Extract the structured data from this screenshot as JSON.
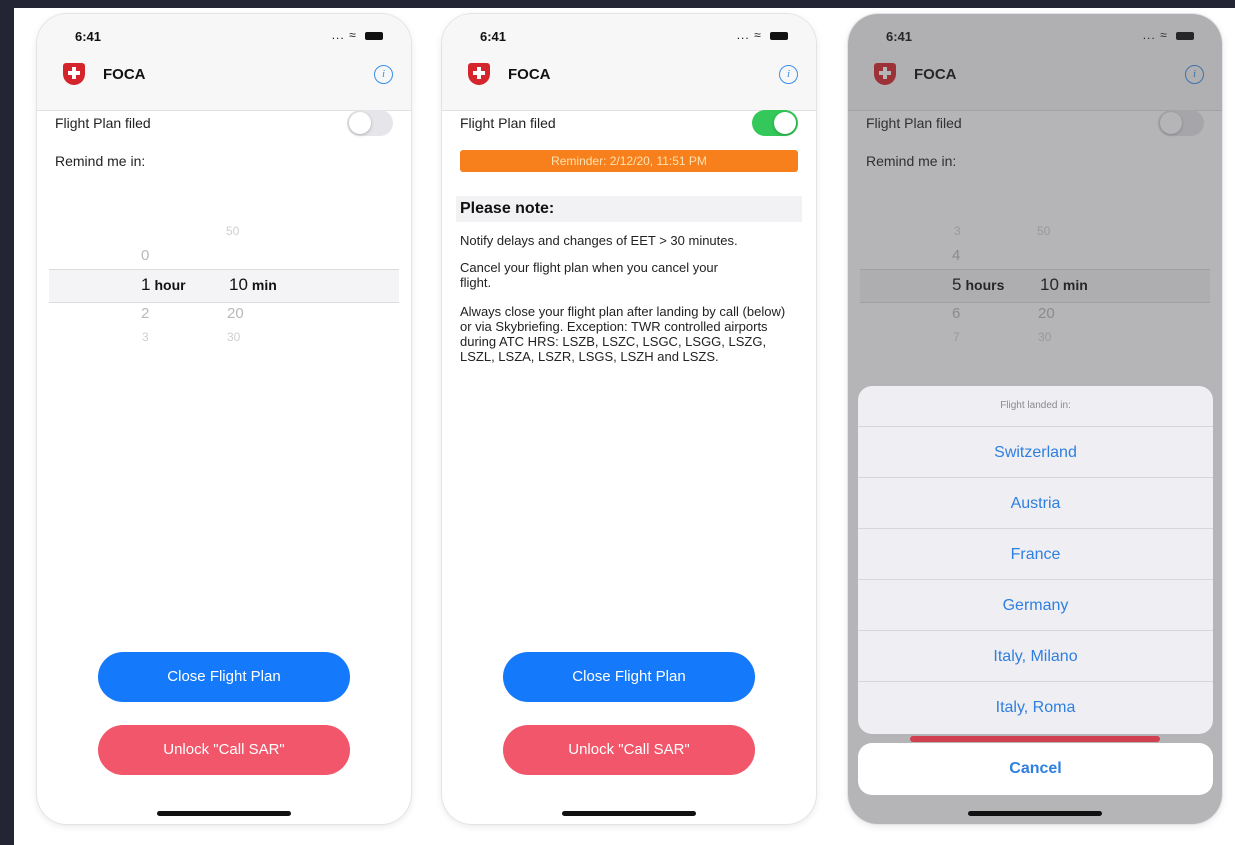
{
  "screens": [
    {
      "time": "6:41",
      "signal": "...",
      "app_title": "FOCA",
      "flight_plan_label": "Flight Plan filed",
      "remind_label": "Remind me in:",
      "toggle_on": false,
      "picker": {
        "hours_above": [
          "",
          "0"
        ],
        "hour_selected": "1",
        "hour_unit": "hour",
        "hours_below": [
          "2",
          "3",
          ""
        ],
        "mins_above": [
          "",
          "50",
          ""
        ],
        "min_selected": "10",
        "min_unit": "min",
        "mins_below": [
          "20",
          "30",
          ""
        ]
      },
      "close_button": "Close Flight Plan",
      "sar_button": "Unlock \"Call SAR\""
    },
    {
      "time": "6:41",
      "signal": "...",
      "app_title": "FOCA",
      "flight_plan_label": "Flight Plan filed",
      "toggle_on": true,
      "reminder": "Reminder: 2/12/20, 11:51 PM",
      "note_title": "Please note:",
      "notes": [
        "Notify delays and changes of EET > 30 minutes.",
        "Cancel your flight plan when you cancel your flight.",
        "Always close your flight plan after landing by call (below) or via Skybriefing. Exception: TWR controlled airports during ATC HRS: LSZB, LSZC, LSGC, LSGG, LSZG, LSZL, LSZA, LSZR, LSGS, LSZH and LSZS."
      ],
      "close_button": "Close Flight Plan",
      "sar_button": "Unlock \"Call SAR\""
    },
    {
      "time": "6:41",
      "signal": "...",
      "app_title": "FOCA",
      "flight_plan_label": "Flight Plan filed",
      "remind_label": "Remind me in:",
      "toggle_on": false,
      "picker": {
        "hours_above": [
          "3",
          "4"
        ],
        "hour_selected": "5",
        "hour_unit": "hours",
        "hours_below": [
          "6",
          "7",
          ""
        ],
        "mins_above": [
          "",
          "50",
          ""
        ],
        "min_selected": "10",
        "min_unit": "min",
        "mins_below": [
          "20",
          "30",
          ""
        ]
      },
      "sheet_title": "Flight landed in:",
      "options": [
        "Switzerland",
        "Austria",
        "France",
        "Germany",
        "Italy, Milano",
        "Italy, Roma"
      ],
      "cancel_label": "Cancel"
    }
  ],
  "colors": {
    "primary_blue": "#1479fb",
    "sar_red": "#f1566a",
    "reminder_orange": "#f7801c",
    "toggle_green": "#34c759",
    "swiss_red": "#d5252c"
  },
  "icons": {
    "logo": "swiss-cross-shield-icon",
    "info": "info-circle-icon",
    "wifi": "wifi-icon",
    "battery": "battery-icon"
  }
}
